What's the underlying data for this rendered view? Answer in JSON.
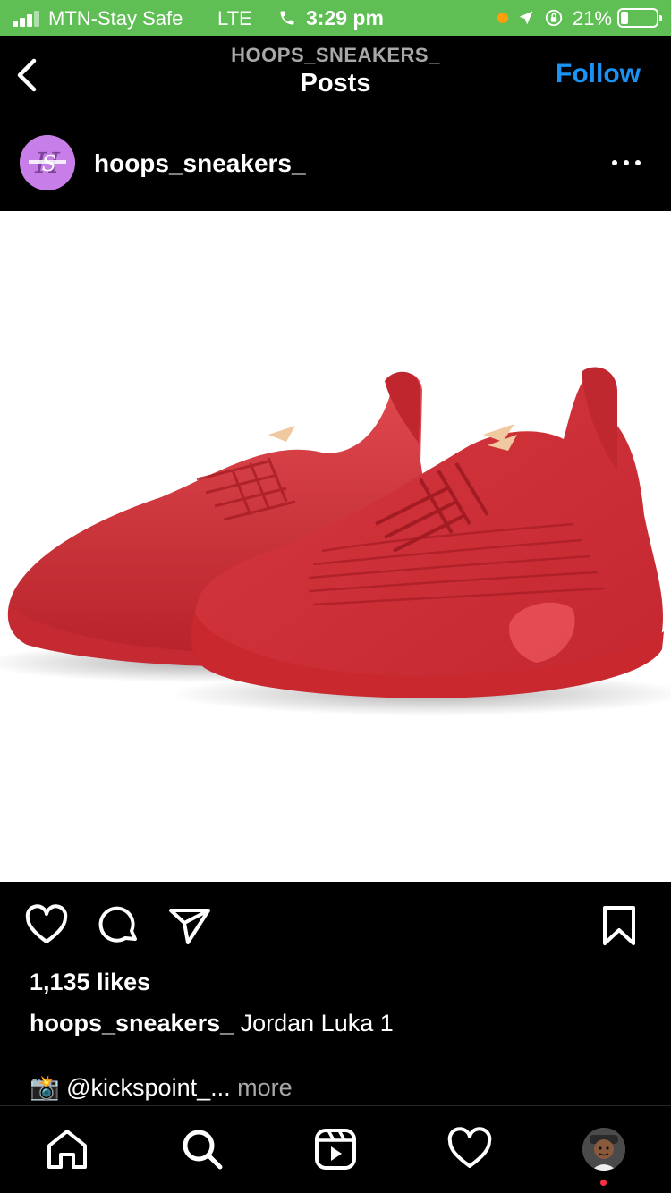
{
  "status_bar": {
    "carrier": "MTN-Stay Safe",
    "network": "LTE",
    "time": "3:29 pm",
    "battery": "21%",
    "battery_level": 0.21
  },
  "header": {
    "account": "HOOPS_SNEAKERS_",
    "title": "Posts",
    "follow_label": "Follow"
  },
  "post": {
    "username": "hoops_sneakers_",
    "likes": "1,135 likes",
    "caption_user": "hoops_sneakers_",
    "caption_text": " Jordan Luka 1",
    "caption_line2_emoji": "📸",
    "caption_line2_text": " @kickspoint_...",
    "caption_more": " more"
  },
  "colors": {
    "status_bar": "#5fbf54",
    "follow": "#1a93f5",
    "avatar": "#c77ee8",
    "shoe": "#d8323a",
    "notification_dot": "#ff3040"
  },
  "icons": {
    "back": "chevron-left-icon",
    "more": "ellipsis-icon",
    "like": "heart-icon",
    "comment": "comment-icon",
    "share": "send-icon",
    "save": "bookmark-icon",
    "home": "home-icon",
    "search": "search-icon",
    "reels": "reels-icon",
    "activity": "heart-icon",
    "profile": "profile-avatar"
  }
}
